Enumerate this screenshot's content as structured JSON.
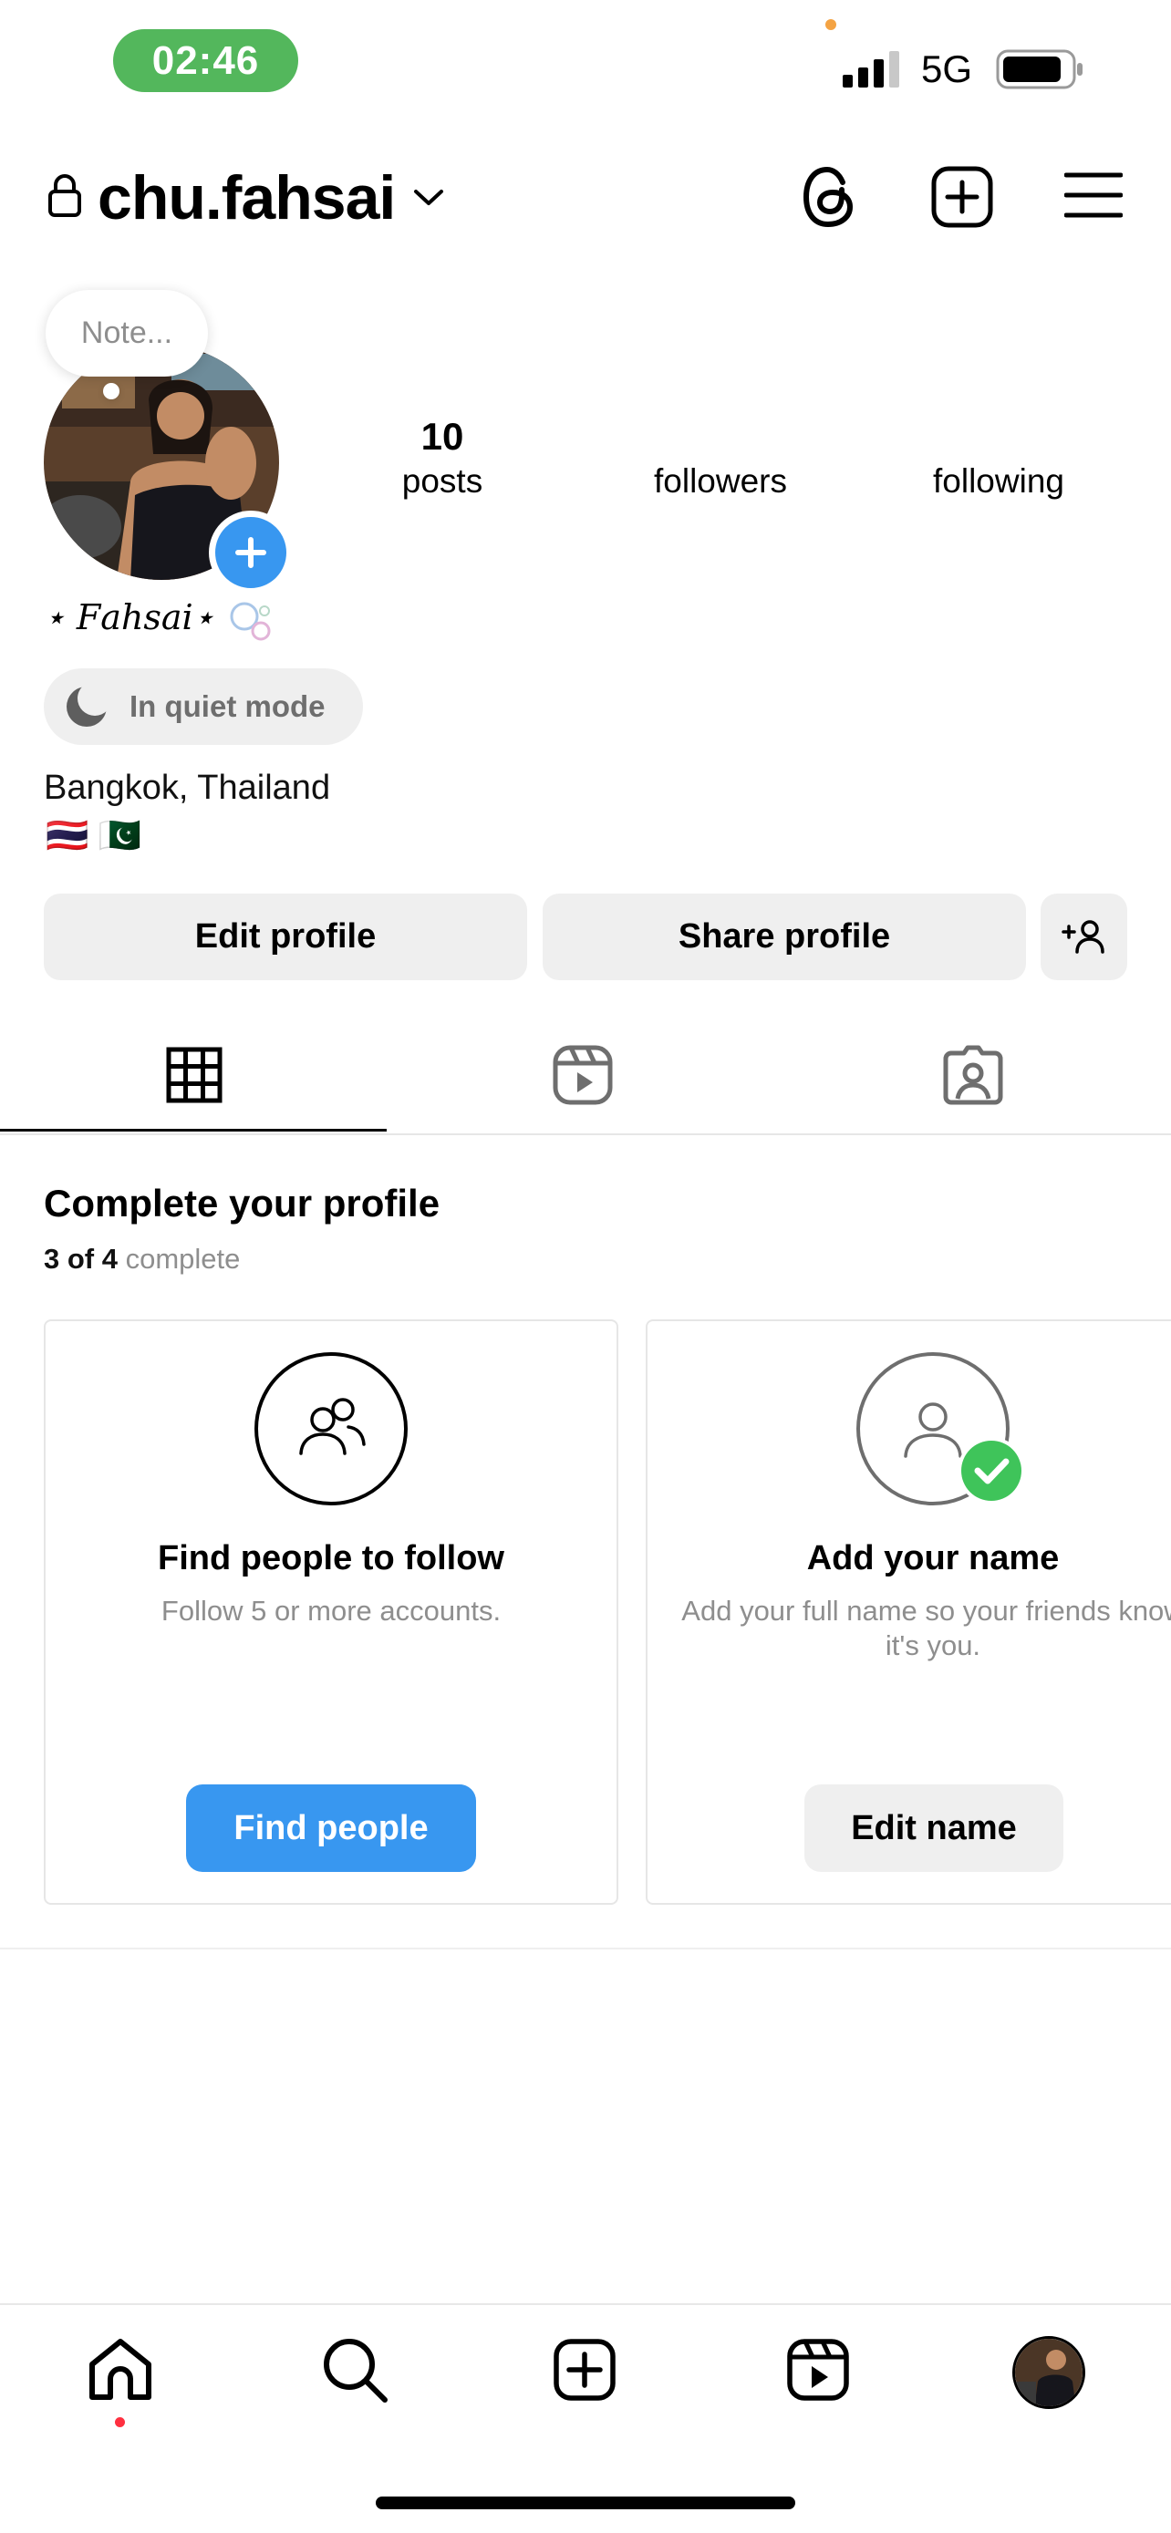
{
  "status_bar": {
    "time": "02:46",
    "network": "5G"
  },
  "header": {
    "username": "chu.fahsai",
    "icons": [
      "lock-icon",
      "chevron-down-icon",
      "threads-icon",
      "create-plus-icon",
      "menu-icon"
    ]
  },
  "profile": {
    "note_placeholder": "Note...",
    "stats": [
      {
        "value": "10",
        "label": "posts"
      },
      {
        "value": "",
        "label": "followers"
      },
      {
        "value": "",
        "label": "following"
      }
    ],
    "display_name": "⋆ 𝐹𝑎ℎ𝑠𝑎𝑖⋆",
    "quiet_mode": "In quiet mode",
    "location": "Bangkok, Thailand",
    "flags": "🇹🇭 🇵🇰"
  },
  "actions": {
    "edit_profile": "Edit profile",
    "share_profile": "Share profile"
  },
  "tabs": [
    "grid-tab",
    "reels-tab",
    "tagged-tab"
  ],
  "complete_profile": {
    "title": "Complete your profile",
    "progress_prefix": "3 of 4",
    "progress_suffix": " complete",
    "cards": [
      {
        "title": "Find people to follow",
        "subtitle": "Follow 5 or more accounts.",
        "button": "Find people"
      },
      {
        "title": "Add your name",
        "subtitle": "Add your full name so your friends know it's you.",
        "button": "Edit name"
      }
    ]
  },
  "bottom_nav": [
    "home-icon",
    "search-icon",
    "create-icon",
    "reels-icon",
    "profile-avatar"
  ],
  "colors": {
    "accent_blue": "#3897f0",
    "status_green": "#53b75c",
    "check_green": "#3fc45a",
    "notification_red": "#ff3040"
  }
}
